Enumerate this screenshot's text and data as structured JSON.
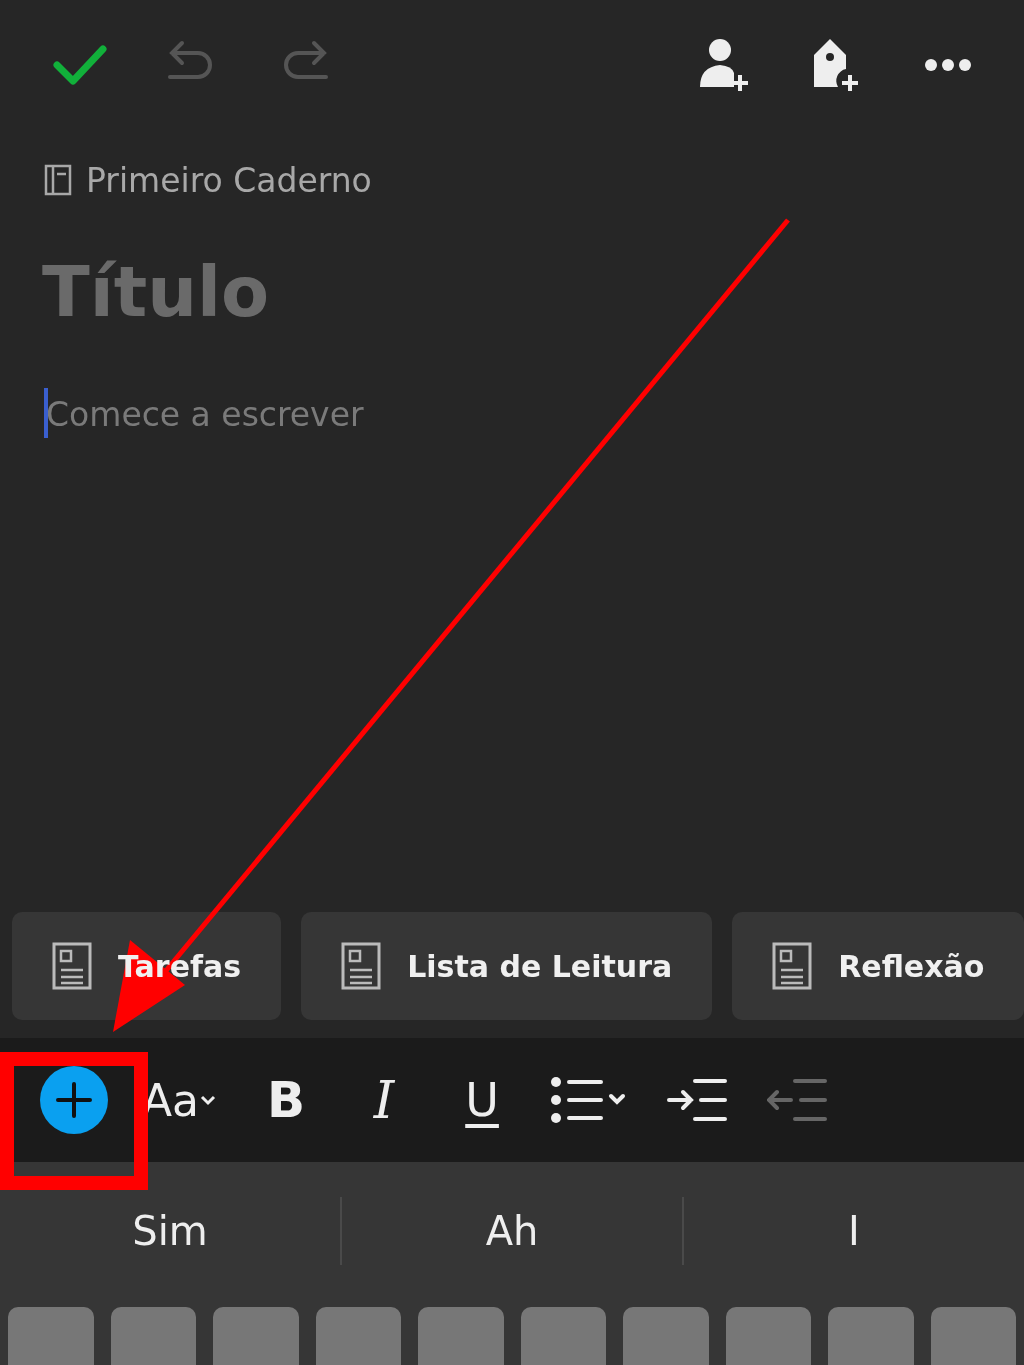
{
  "toolbar": {
    "actions": [
      {
        "kind": "done",
        "disabled": false
      },
      {
        "kind": "undo",
        "disabled": true
      },
      {
        "kind": "redo",
        "disabled": true
      },
      {
        "kind": "share",
        "disabled": false
      },
      {
        "kind": "tag",
        "disabled": false
      },
      {
        "kind": "more",
        "disabled": false
      }
    ]
  },
  "notebook": "Primeiro Caderno",
  "note": {
    "title": {
      "placeholder": "Título"
    },
    "body": {
      "placeholder": "Comece a escrever"
    }
  },
  "templates": [
    "Tarefas",
    "Lista de Leitura",
    "Reflexão"
  ],
  "format_bar": {
    "items": [
      {
        "kind": "insert"
      },
      {
        "kind": "text",
        "label": "Aa"
      },
      {
        "kind": "bold",
        "label": "B"
      },
      {
        "kind": "italic",
        "label": "I"
      },
      {
        "kind": "underline",
        "label": "U"
      },
      {
        "kind": "list"
      },
      {
        "kind": "indent"
      },
      {
        "kind": "outdent"
      }
    ]
  },
  "suggestions": [
    "Sim",
    "Ah",
    "I"
  ]
}
